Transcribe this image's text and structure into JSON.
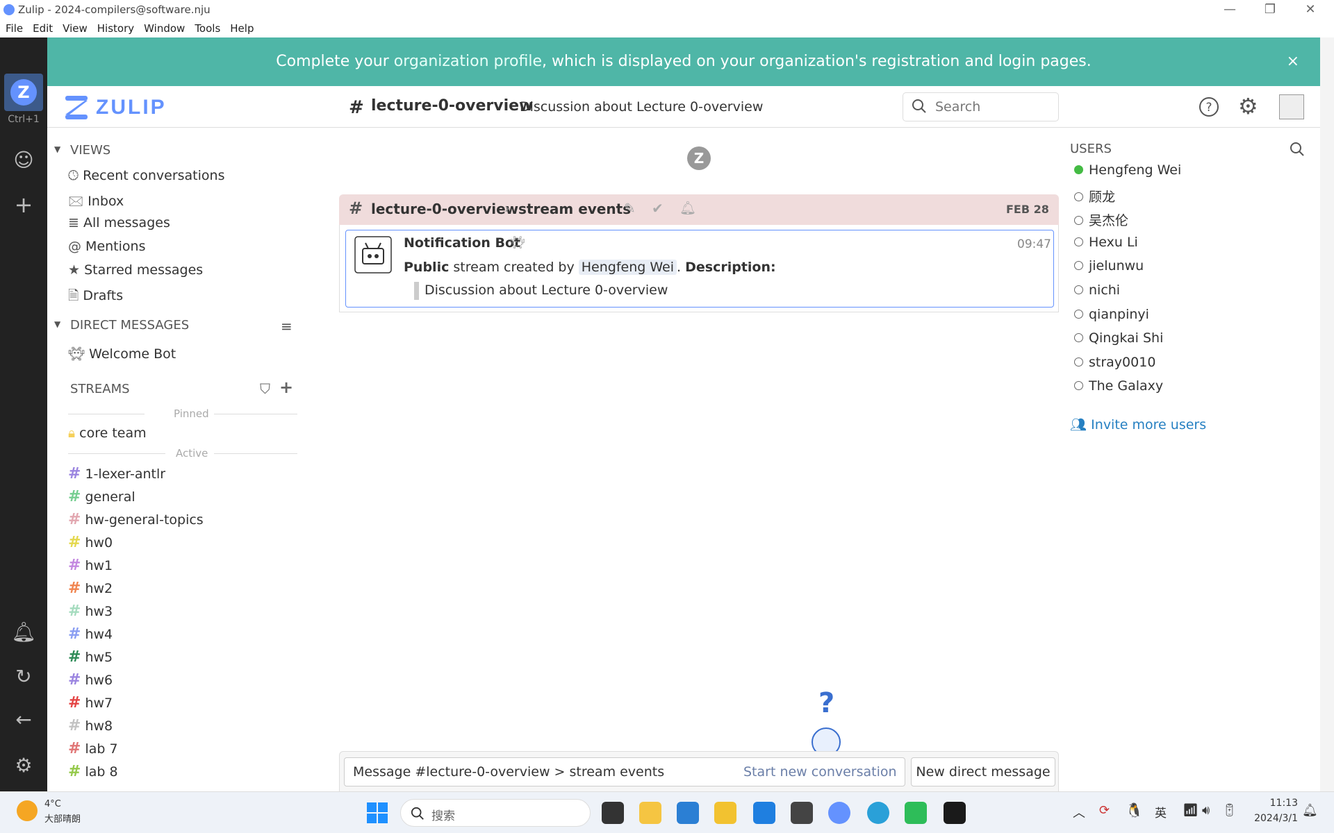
{
  "window": {
    "title": "Zulip - 2024-compilers@software.nju"
  },
  "menu": [
    "File",
    "Edit",
    "View",
    "History",
    "Window",
    "Tools",
    "Help"
  ],
  "dark_sidebar": {
    "shortcut": "Ctrl+1"
  },
  "banner": {
    "pre": "Complete your ",
    "link": "organization profile",
    "post": ", which is displayed on your organization's registration and login pages.",
    "close": "×"
  },
  "header": {
    "logo_text": "ZULIP",
    "stream": "lecture-0-overview",
    "description": "Discussion about Lecture 0-overview",
    "search_placeholder": "Search"
  },
  "views": {
    "title": "VIEWS",
    "items": [
      {
        "label": "Recent conversations",
        "icon": "🕓"
      },
      {
        "label": "Inbox",
        "icon": "🖂"
      },
      {
        "label": "All messages",
        "icon": "≣"
      },
      {
        "label": "Mentions",
        "icon": "@"
      },
      {
        "label": "Starred messages",
        "icon": "★"
      },
      {
        "label": "Drafts",
        "icon": "🗎"
      }
    ]
  },
  "direct_messages": {
    "title": "DIRECT MESSAGES",
    "items": [
      "Welcome Bot"
    ]
  },
  "streams": {
    "title": "STREAMS",
    "pinned_label": "Pinned",
    "active_label": "Active",
    "pinned": [
      {
        "name": "core team",
        "color": "#f5d05a"
      }
    ],
    "active": [
      {
        "name": "1-lexer-antlr",
        "color": "#9b85e0"
      },
      {
        "name": "general",
        "color": "#76ce90"
      },
      {
        "name": "hw-general-topics",
        "color": "#e2a7b0"
      },
      {
        "name": "hw0",
        "color": "#e4d84e"
      },
      {
        "name": "hw1",
        "color": "#c387e0"
      },
      {
        "name": "hw2",
        "color": "#f08550"
      },
      {
        "name": "hw3",
        "color": "#a6dcbf"
      },
      {
        "name": "hw4",
        "color": "#8a9ef2"
      },
      {
        "name": "hw5",
        "color": "#2e8b57"
      },
      {
        "name": "hw6",
        "color": "#9b85e0"
      },
      {
        "name": "hw7",
        "color": "#e44444"
      },
      {
        "name": "hw8",
        "color": "#c2c2c2"
      },
      {
        "name": "lab 7",
        "color": "#e07575"
      },
      {
        "name": "lab 8",
        "color": "#95c94b"
      }
    ]
  },
  "recipient": {
    "stream": "lecture-0-overview",
    "topic": "stream events",
    "date": "FEB 28"
  },
  "message": {
    "sender": "Notification Bot",
    "time": "09:47",
    "text_bold": "Public",
    "text_mid": " stream created by ",
    "mention": "Hengfeng Wei",
    "text_after": ". ",
    "desc_label": "Description:",
    "quote": "Discussion about Lecture 0-overview"
  },
  "users": {
    "title": "USERS",
    "list": [
      {
        "name": "Hengfeng Wei",
        "active": true
      },
      {
        "name": "顾龙",
        "active": false
      },
      {
        "name": "吴杰伦",
        "active": false
      },
      {
        "name": "Hexu Li",
        "active": false
      },
      {
        "name": "jielunwu",
        "active": false
      },
      {
        "name": "nichi",
        "active": false
      },
      {
        "name": "qianpinyi",
        "active": false
      },
      {
        "name": "Qingkai Shi",
        "active": false
      },
      {
        "name": "stray0010",
        "active": false
      },
      {
        "name": "The Galaxy",
        "active": false
      }
    ],
    "invite": "Invite more users"
  },
  "compose": {
    "placeholder": "Message #lecture-0-overview > stream events",
    "new_conversation": "Start new conversation",
    "new_dm": "New direct message",
    "help_mark": "?"
  },
  "taskbar": {
    "temp": "4°C",
    "weather": "大部晴朗",
    "search_placeholder": "搜索",
    "ime": "英",
    "time": "11:13",
    "date": "2024/3/1"
  },
  "colors": {
    "accent": "#6492fe",
    "banner": "#4fb6a7",
    "recipient_bar": "#f0dcdc",
    "presence_active": "#44bb44"
  }
}
